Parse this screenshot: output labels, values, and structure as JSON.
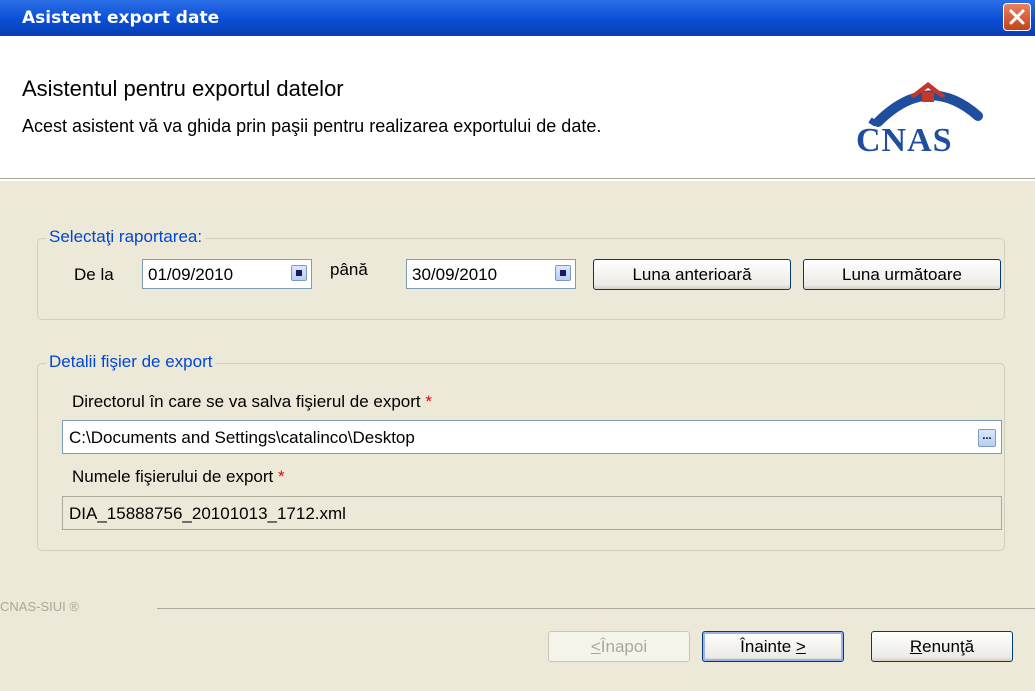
{
  "window": {
    "title": "Asistent export date"
  },
  "header": {
    "title": "Asistentul pentru exportul datelor",
    "subtitle": "Acest asistent vă va ghida prin paşii pentru realizarea exportului de date.",
    "logo_text": "CNAS"
  },
  "report_group": {
    "legend": "Selectaţi raportarea:",
    "from_label": "De la",
    "from_value": "01/09/2010",
    "to_label": "până",
    "to_value": "30/09/2010",
    "prev_month_label": "Luna anterioară",
    "next_month_label": "Luna următoare"
  },
  "export_group": {
    "legend": "Detalii fişier de export",
    "dir_label": "Directorul în care se va salva fişierul de export",
    "required_mark": "*",
    "dir_value": "C:\\Documents and Settings\\catalinco\\Desktop",
    "browse_label": "...",
    "file_label": "Numele fişierului de export",
    "file_value": "DIA_15888756_20101013_1712.xml"
  },
  "footer": {
    "brand": "CNAS-SIUI ®",
    "back_prefix": "<",
    "back_label": " Înapoi",
    "next_label": "Înainte ",
    "next_suffix": ">",
    "cancel_first": "R",
    "cancel_rest": "enunţă"
  },
  "colors": {
    "titlebar": "#0a4ed5",
    "legend_text": "#0046d5",
    "required": "#e00000",
    "logo": "#1f4e9e",
    "logo_accent": "#c0392b"
  }
}
